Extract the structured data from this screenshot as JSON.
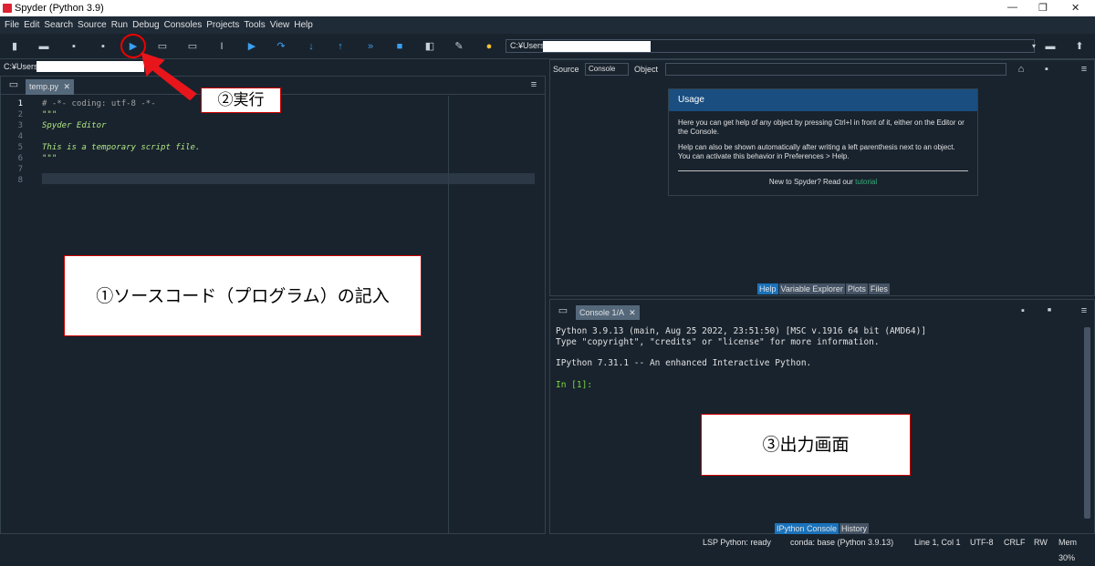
{
  "window": {
    "title": "Spyder (Python 3.9)",
    "min": "—",
    "max": "❐",
    "close": "✕"
  },
  "menu": [
    "File",
    "Edit",
    "Search",
    "Source",
    "Run",
    "Debug",
    "Consoles",
    "Projects",
    "Tools",
    "View",
    "Help"
  ],
  "toolbar": {
    "path": "C:¥Users"
  },
  "editor": {
    "path": "C:¥Users",
    "tab": "temp.py",
    "tab_close": "✕",
    "lines": [
      "1",
      "2",
      "3",
      "4",
      "5",
      "6",
      "7",
      "8"
    ],
    "code": [
      "# -*- coding: utf-8 -*-",
      "\"\"\"",
      "Spyder Editor",
      "",
      "This is a temporary script file.",
      "\"\"\"",
      "",
      ""
    ]
  },
  "help": {
    "source_label": "Source",
    "source_value": "Console",
    "object_label": "Object",
    "usage_title": "Usage",
    "usage_p1": "Here you can get help of any object by pressing Ctrl+I in front of it, either on the Editor or the Console.",
    "usage_p2": "Help can also be shown automatically after writing a left parenthesis next to an object. You can activate this behavior in Preferences > Help.",
    "usage_footer": "New to Spyder? Read our",
    "usage_link": "tutorial",
    "tabs": [
      "Help",
      "Variable Explorer",
      "Plots",
      "Files"
    ]
  },
  "console": {
    "tab": "Console 1/A",
    "tab_close": "✕",
    "lines": [
      "Python 3.9.13 (main, Aug 25 2022, 23:51:50) [MSC v.1916 64 bit (AMD64)]",
      "Type \"copyright\", \"credits\" or \"license\" for more information.",
      "",
      "IPython 7.31.1 -- An enhanced Interactive Python.",
      ""
    ],
    "prompt": "In [1]:",
    "tabs": [
      "IPython Console",
      "History"
    ]
  },
  "status": {
    "lsp": "LSP Python: ready",
    "conda": "conda: base (Python 3.9.13)",
    "pos": "Line 1, Col 1",
    "enc": "UTF-8",
    "eol": "CRLF",
    "rw": "RW",
    "mem": "Mem 30%"
  },
  "annotations": {
    "a1": "①ソースコード（プログラム）の記入",
    "a2": "②実行",
    "a3": "③出力画面"
  }
}
